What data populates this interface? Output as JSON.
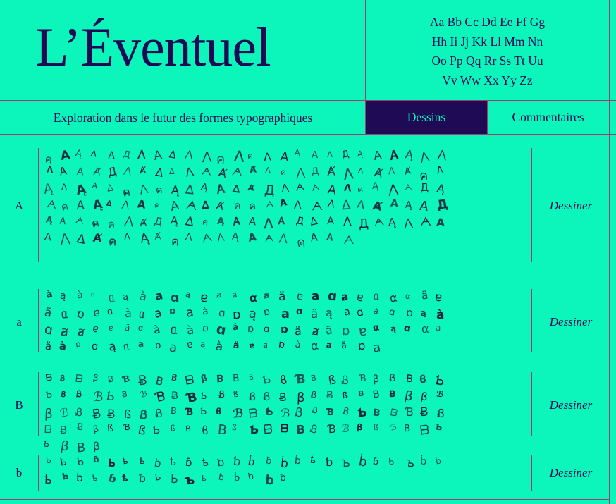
{
  "header": {
    "title": "L’Éventuel",
    "alphabet": [
      "Aa Bb Cc Dd Ee Ff Gg",
      "Hh Ii Jj Kk Ll Mm Nn",
      "Oo Pp Qq Rr Ss Tt Uu",
      "Vv Ww Xx Yy Zz"
    ]
  },
  "nav": {
    "subtitle": "Exploration dans le futur des formes typographiques",
    "tabs": [
      {
        "label": "Dessins",
        "active": true
      },
      {
        "label": "Commentaires",
        "active": false
      }
    ]
  },
  "rows": [
    {
      "letter": "A",
      "action": "Dessiner",
      "count": 150
    },
    {
      "letter": "a",
      "action": "Dessiner",
      "count": 100
    },
    {
      "letter": "B",
      "action": "Dessiner",
      "count": 108
    },
    {
      "letter": "b",
      "action": "Dessiner",
      "count": 42
    }
  ],
  "colors": {
    "background": "#0cf5bb",
    "ink": "#1e0a55",
    "rule": "#a23c6a"
  }
}
